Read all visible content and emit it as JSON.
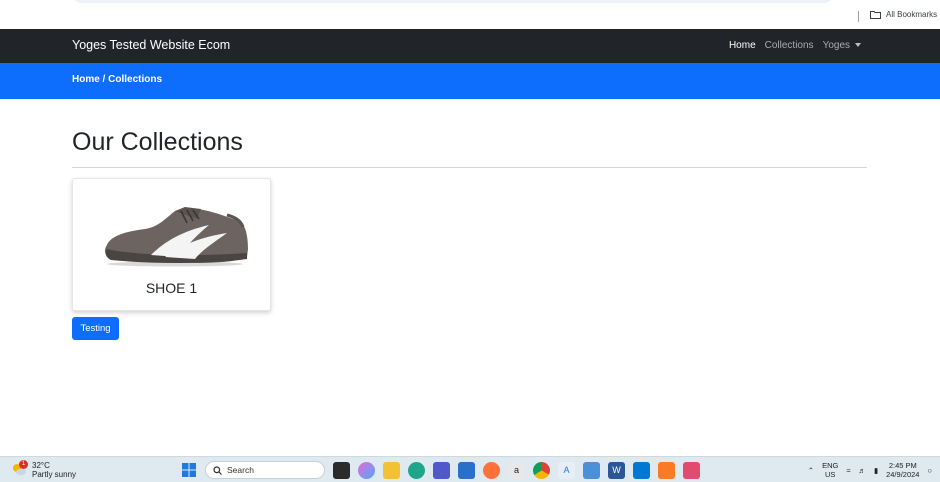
{
  "browser": {
    "bookmarks_label": "All Bookmarks"
  },
  "navbar": {
    "brand": "Yoges Tested Website Ecom",
    "links": [
      {
        "label": "Home"
      },
      {
        "label": "Collections"
      },
      {
        "label": "Yoges"
      }
    ]
  },
  "breadcrumb": {
    "text": "Home / Collections"
  },
  "main": {
    "title": "Our Collections",
    "card": {
      "title": "SHOE 1"
    },
    "button": "Testing"
  },
  "taskbar": {
    "weather_temp": "32°C",
    "weather_desc": "Partly sunny",
    "weather_badge": "1",
    "search_label": "Search",
    "lang_top": "ENG",
    "lang_bottom": "US",
    "time": "2:45 PM",
    "date": "24/9/2024"
  }
}
